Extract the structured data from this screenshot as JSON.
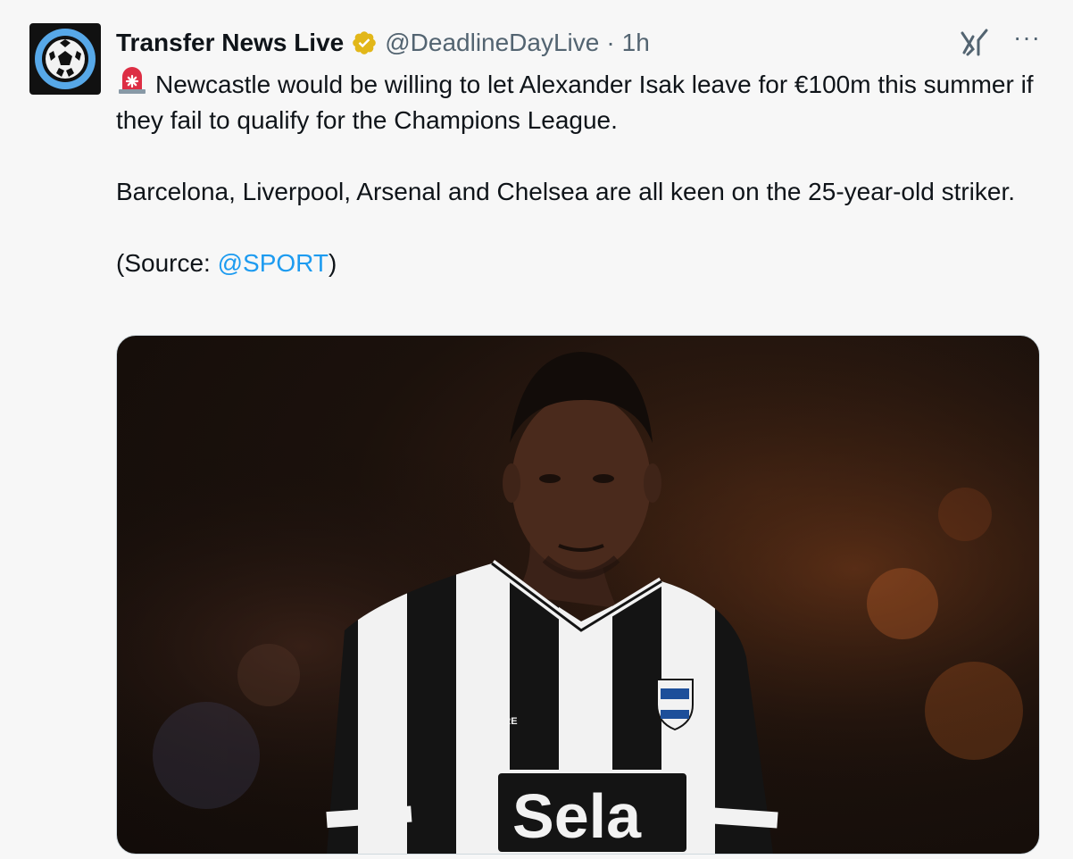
{
  "tweet": {
    "author": {
      "name": "Transfer News Live",
      "handle": "@DeadlineDayLive",
      "separator": "·",
      "time": "1h",
      "avatar_icon": "soccer-ball-icon",
      "verified_icon": "verified-badge-icon"
    },
    "actions": {
      "grok_icon": "grok-icon",
      "more_label": "···"
    },
    "body": {
      "line1_icon": "siren-emoji-icon",
      "line1": "Newcastle would be willing to let Alexander Isak leave for €100m this summer if they fail to qualify for the Champions League.",
      "line2": "Barcelona, Liverpool, Arsenal and Chelsea are all keen on the 25-year-old striker.",
      "source_prefix": "(Source: ",
      "source_mention": "@SPORT",
      "source_suffix": ")"
    },
    "media": {
      "jersey_brand": "CASTORE",
      "sponsor": "Sela"
    }
  },
  "colors": {
    "text": "#0f1419",
    "secondary": "#536471",
    "link": "#1d9bf0",
    "verified": "#e2b719",
    "background": "#f7f7f7"
  }
}
